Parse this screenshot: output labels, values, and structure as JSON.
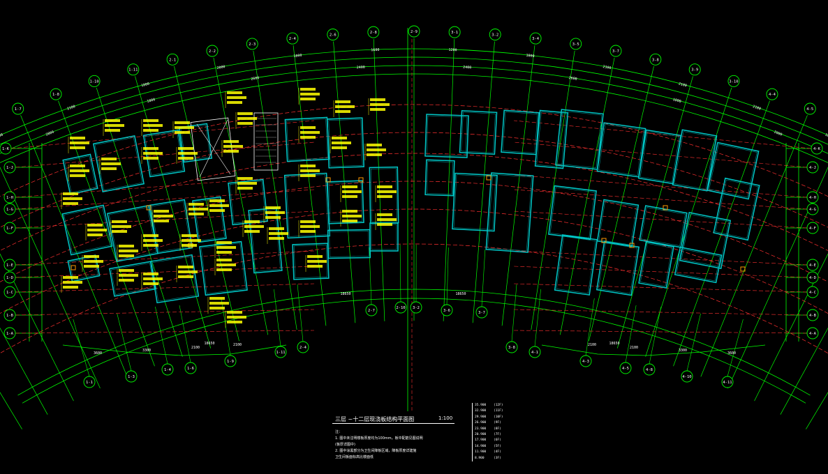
{
  "drawing": {
    "title": "三层 ~十二层现浇板结构平面图",
    "scale": "1:100",
    "notes_header": "注：",
    "notes": [
      "1. 图中未注明楼板厚度均为100mm，板中配筋见图说明",
      "   (板厚详图中)",
      "2. 图中涂黑部分为卫生间降板区域，降板厚度详建施",
      "   卫生间板面标高比楼面低"
    ],
    "elevations": [
      {
        "elev": "35.900",
        "floor": "(12F)"
      },
      {
        "elev": "32.900",
        "floor": "(11F)"
      },
      {
        "elev": "29.900",
        "floor": "(10F)"
      },
      {
        "elev": "26.900",
        "floor": "(9F)"
      },
      {
        "elev": "23.900",
        "floor": "(8F)"
      },
      {
        "elev": "20.900",
        "floor": "(7F)"
      },
      {
        "elev": "17.900",
        "floor": "(6F)"
      },
      {
        "elev": "14.900",
        "floor": "(5F)"
      },
      {
        "elev": "11.900",
        "floor": "(4F)"
      },
      {
        "elev": "8.900",
        "floor": "(3F)"
      }
    ]
  },
  "axes": {
    "left_top": [
      "1-1",
      "1-2",
      "1-3",
      "1-5",
      "1-7",
      "1-8",
      "1-10",
      "1-11",
      "2-1",
      "2-2",
      "2-3",
      "2-4",
      "2-6",
      "2-8",
      "2-9"
    ],
    "right_top": [
      "3-1",
      "3-2",
      "3-4",
      "3-5",
      "3-7",
      "3-8",
      "3-9",
      "3-10",
      "4-4",
      "4-5",
      "4-7",
      "4-9",
      "4-11",
      "4-12"
    ],
    "left_side": [
      "1-K",
      "1-J",
      "1-H",
      "1-G",
      "1-F",
      "1-E",
      "1-D",
      "1-C",
      "1-B",
      "1-A"
    ],
    "right_side": [
      "4-K",
      "4-J",
      "4-H",
      "4-G",
      "4-F",
      "4-E",
      "4-D",
      "4-C",
      "4-B",
      "4-A"
    ],
    "left_bottom": [
      "1-1",
      "1-3",
      "1-4",
      "1-6",
      "1-9",
      "1-11",
      "2-4",
      "2-7",
      "2-10"
    ],
    "right_bottom": [
      "3-2",
      "3-6",
      "3-7",
      "3-8",
      "4-1",
      "4-3",
      "4-5",
      "4-8",
      "4-10",
      "4-11"
    ]
  },
  "dimensions": {
    "top_row": [
      "11350",
      "2100",
      "2100",
      "1800",
      "2000",
      "1800",
      "1600",
      "1200",
      "1800",
      "2100",
      "2100",
      "2100",
      "1800",
      "11350"
    ],
    "second_row": [
      "2500",
      "2800",
      "1800",
      "2600",
      "2400",
      "2400",
      "2600",
      "1800",
      "2800",
      "2500"
    ],
    "bottom_row": [
      "3600",
      "3300",
      "2100",
      "2100",
      "2100",
      "2100",
      "3300",
      "3600"
    ],
    "totals": [
      "18650",
      "18650",
      "18650",
      "18650"
    ]
  },
  "colors": {
    "background": "#000000",
    "axis": "#00ff00",
    "wall": "#00c8c8",
    "beam_dash": "#ff3030",
    "annotation": "#ffff00",
    "text": "#ffffff"
  }
}
